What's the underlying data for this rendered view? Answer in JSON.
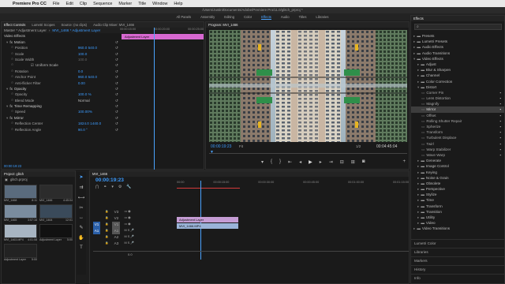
{
  "menubar": {
    "apple": "",
    "app": "Premiere Pro CC",
    "items": [
      "File",
      "Edit",
      "Clip",
      "Sequence",
      "Marker",
      "Title",
      "Window",
      "Help"
    ]
  },
  "window_title": "/Users/Justin/Documents/Adobe/Premiere Pro/11.0/glitch_prproj *",
  "workspaces": [
    "All Panels",
    "Assembly",
    "Editing",
    "Color",
    "Effects",
    "Audio",
    "Titles",
    "Libraries"
  ],
  "workspace_active": "Effects",
  "effect_controls": {
    "tabs": [
      "Effect Controls",
      "Lumetri Scopes",
      "Source: (no clips)",
      "Audio Clip Mixer: MVI_1466"
    ],
    "source_label": "Master * Adjustment Layer",
    "clip_label": "MVI_1466 * Adjustment Layer",
    "clip_bar_label": "Adjustment Layer",
    "ruler": [
      "00:00:15:00",
      "00:00:20:00",
      "00:00:25:00"
    ],
    "section": "Video Effects",
    "params": [
      {
        "name": "Motion",
        "value": "",
        "indent": 1,
        "type": "fold"
      },
      {
        "name": "Position",
        "value": "960.0   540.0",
        "indent": 2
      },
      {
        "name": "Scale",
        "value": "100.0",
        "indent": 2
      },
      {
        "name": "Scale Width",
        "value": "100.0",
        "indent": 2,
        "dim": true
      },
      {
        "name": "",
        "value": "Uniform Scale",
        "indent": 2,
        "type": "check"
      },
      {
        "name": "Rotation",
        "value": "0.0",
        "indent": 2
      },
      {
        "name": "Anchor Point",
        "value": "960.0   540.0",
        "indent": 2
      },
      {
        "name": "Anti-flicker Filter",
        "value": "0.00",
        "indent": 2
      },
      {
        "name": "Opacity",
        "value": "",
        "indent": 1,
        "type": "fold"
      },
      {
        "name": "Opacity",
        "value": "100.0 %",
        "indent": 2
      },
      {
        "name": "Blend Mode",
        "value": "Normal",
        "indent": 2,
        "type": "select"
      },
      {
        "name": "Time Remapping",
        "value": "",
        "indent": 1,
        "type": "fold"
      },
      {
        "name": "Speed",
        "value": "100.00%",
        "indent": 2
      },
      {
        "name": "Mirror",
        "value": "",
        "indent": 1,
        "type": "fold"
      },
      {
        "name": "Reflection Center",
        "value": "1824.0   1440.0",
        "indent": 2
      },
      {
        "name": "Reflection Angle",
        "value": "90.0 °",
        "indent": 2
      }
    ],
    "timecode": "00:00:19:23"
  },
  "program": {
    "title": "Program: MVI_1466",
    "timecode": "00:00:19:23",
    "fit": "Fit",
    "fraction": "1/2",
    "duration": "00:04:45:04"
  },
  "project": {
    "title": "Project: glitch",
    "file": "glitch.prproj",
    "items": [
      {
        "name": "MVI_1468",
        "dur": "8:11"
      },
      {
        "name": "MVI_1466",
        "dur": "4:45:04"
      },
      {
        "name": "MVI_1465",
        "dur": "3:57:16"
      },
      {
        "name": "MVI_1464",
        "dur": "12:01"
      },
      {
        "name": "MVI_1463.MP4",
        "dur": "4:01:08"
      },
      {
        "name": "Adjustment Layer",
        "dur": "5:00"
      },
      {
        "name": "Adjustment Layer",
        "dur": "5:00"
      }
    ]
  },
  "timeline": {
    "tab": "MVI_1466",
    "timecode": "00:00:19:23",
    "ruler": [
      "00:00",
      "00:00:15:00",
      "00:00:30:00",
      "00:00:45:00",
      "00:01:00:00",
      "00:01:15:00"
    ],
    "tracks": [
      "V3",
      "V2",
      "V1",
      "A1",
      "A2",
      "A3"
    ],
    "src": [
      "V1",
      "A1"
    ],
    "clips": [
      {
        "label": "Adjustment Layer",
        "color": "#c59cd4"
      },
      {
        "label": "MVI_1466.MP4",
        "color": "#9ab3d8"
      }
    ],
    "footer": "0.0"
  },
  "effects": {
    "title": "Effects",
    "search": "",
    "tree": [
      {
        "label": "Presets",
        "type": "folder",
        "depth": 0
      },
      {
        "label": "Lumetri Presets",
        "type": "folder",
        "depth": 0
      },
      {
        "label": "Audio Effects",
        "type": "folder",
        "depth": 0
      },
      {
        "label": "Audio Transitions",
        "type": "folder",
        "depth": 0
      },
      {
        "label": "Video Effects",
        "type": "folder",
        "depth": 0,
        "open": true
      },
      {
        "label": "Adjust",
        "type": "folder",
        "depth": 1
      },
      {
        "label": "Blur & Sharpen",
        "type": "folder",
        "depth": 1
      },
      {
        "label": "Channel",
        "type": "folder",
        "depth": 1
      },
      {
        "label": "Color Correction",
        "type": "folder",
        "depth": 1
      },
      {
        "label": "Distort",
        "type": "folder",
        "depth": 1,
        "open": true
      },
      {
        "label": "Corner Pin",
        "type": "item",
        "depth": 2
      },
      {
        "label": "Lens Distortion",
        "type": "item",
        "depth": 2
      },
      {
        "label": "Magnify",
        "type": "item",
        "depth": 2
      },
      {
        "label": "Mirror",
        "type": "item",
        "depth": 2,
        "selected": true
      },
      {
        "label": "Offset",
        "type": "item",
        "depth": 2
      },
      {
        "label": "Rolling Shutter Repair",
        "type": "item",
        "depth": 2
      },
      {
        "label": "Spherize",
        "type": "item",
        "depth": 2
      },
      {
        "label": "Transform",
        "type": "item",
        "depth": 2
      },
      {
        "label": "Turbulent Displace",
        "type": "item",
        "depth": 2
      },
      {
        "label": "Twirl",
        "type": "item",
        "depth": 2
      },
      {
        "label": "Warp Stabilizer",
        "type": "item",
        "depth": 2
      },
      {
        "label": "Wave Warp",
        "type": "item",
        "depth": 2
      },
      {
        "label": "Generate",
        "type": "folder",
        "depth": 1
      },
      {
        "label": "Image Control",
        "type": "folder",
        "depth": 1
      },
      {
        "label": "Keying",
        "type": "folder",
        "depth": 1
      },
      {
        "label": "Noise & Grain",
        "type": "folder",
        "depth": 1
      },
      {
        "label": "Obsolete",
        "type": "folder",
        "depth": 1
      },
      {
        "label": "Perspective",
        "type": "folder",
        "depth": 1
      },
      {
        "label": "Stylize",
        "type": "folder",
        "depth": 1
      },
      {
        "label": "Time",
        "type": "folder",
        "depth": 1
      },
      {
        "label": "Transform",
        "type": "folder",
        "depth": 1
      },
      {
        "label": "Transition",
        "type": "folder",
        "depth": 1
      },
      {
        "label": "Utility",
        "type": "folder",
        "depth": 1
      },
      {
        "label": "Video",
        "type": "folder",
        "depth": 1
      },
      {
        "label": "Video Transitions",
        "type": "folder",
        "depth": 0
      }
    ],
    "panels": [
      "Lumetri Color",
      "Libraries",
      "Markers",
      "History",
      "Info"
    ]
  },
  "colors": {
    "accent": "#3c9cff",
    "adjustment": "#c59cd4",
    "video_clip": "#9ab3d8",
    "playhead": "#4aa3ff"
  }
}
